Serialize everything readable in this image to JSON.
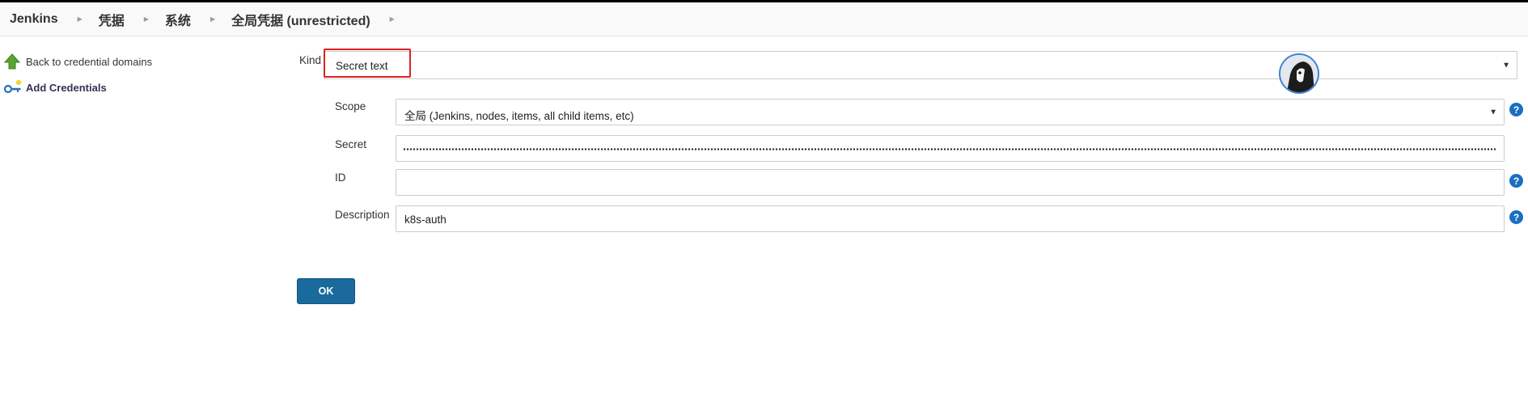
{
  "breadcrumb": {
    "items": [
      "Jenkins",
      "凭据",
      "系统",
      "全局凭据 (unrestricted)"
    ]
  },
  "side_panel": {
    "items": [
      {
        "label": "Back to credential domains",
        "icon": "up-arrow-icon"
      },
      {
        "label": "Add Credentials",
        "icon": "key-icon"
      }
    ]
  },
  "form": {
    "kind": {
      "label": "Kind",
      "value": "Secret text"
    },
    "scope": {
      "label": "Scope",
      "value": "全局 (Jenkins, nodes, items, all child items, etc)"
    },
    "secret": {
      "label": "Secret",
      "value": "••••••••••••••••••••••••••••••••••••••••••••"
    },
    "id": {
      "label": "ID",
      "value": ""
    },
    "description": {
      "label": "Description",
      "value": "k8s-auth"
    },
    "help_glyph": "?"
  },
  "actions": {
    "ok_label": "OK"
  },
  "colors": {
    "primary_button": "#1a6a9e",
    "help_icon": "#1a6fc0",
    "highlight_box": "#e02020",
    "up_arrow": "#5aa532"
  }
}
